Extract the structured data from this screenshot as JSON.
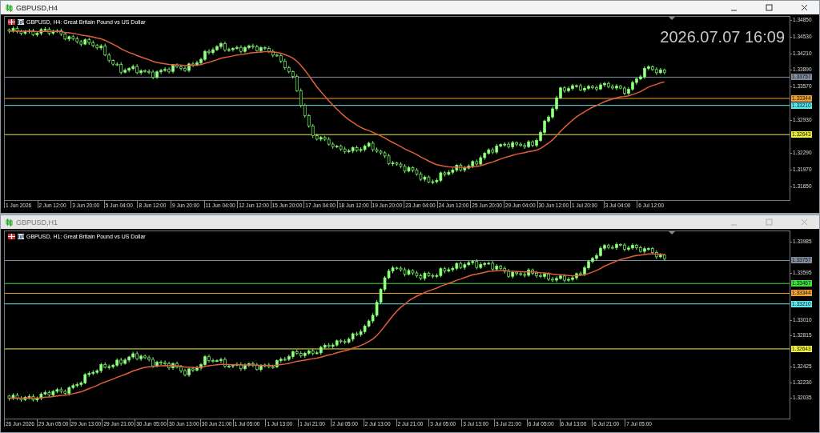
{
  "windows": [
    {
      "title": "GBPUSD,H4",
      "active": true,
      "chart": {
        "header": "GBPUSD, H4: Great Britain Pound vs US Dollar",
        "clock": "2026.07.07 16:09",
        "price_ticks": [
          "1.34850",
          "1.34530",
          "1.34210",
          "1.33890",
          "1.33570",
          "1.32930",
          "1.32290",
          "1.31970",
          "1.31650"
        ],
        "levels": [
          {
            "label": "1.33757",
            "color": "#7f8c9c"
          },
          {
            "label": "1.33344",
            "color": "#f0a030"
          },
          {
            "label": "1.33210",
            "color": "#5ee8f0"
          },
          {
            "label": "1.32643",
            "color": "#f0f040"
          }
        ],
        "time_labels": [
          "1 Jun 2026",
          "2 Jun 12:00",
          "3 Jun 20:00",
          "5 Jun 04:00",
          "8 Jun 12:00",
          "9 Jun 20:00",
          "11 Jun 04:00",
          "12 Jun 12:00",
          "15 Jun 20:00",
          "17 Jun 04:00",
          "18 Jun 12:00",
          "19 Jun 20:00",
          "23 Jun 04:00",
          "24 Jun 12:00",
          "25 Jun 20:00",
          "29 Jun 04:00",
          "30 Jun 12:00",
          "1 Jul 20:00",
          "3 Jul 04:00",
          "6 Jul 12:00"
        ]
      }
    },
    {
      "title": "GBPUSD,H1",
      "active": false,
      "chart": {
        "header": "GBPUSD, H1: Great Britain Pound vs US Dollar",
        "price_ticks": [
          "1.33985",
          "1.33595",
          "1.33010",
          "1.32815",
          "1.32425",
          "1.32230",
          "1.32035"
        ],
        "levels": [
          {
            "label": "1.33757",
            "color": "#7f8c9c"
          },
          {
            "label": "1.33467",
            "color": "#40e040"
          },
          {
            "label": "1.33344",
            "color": "#f0a030"
          },
          {
            "label": "1.33210",
            "color": "#5ee8f0"
          },
          {
            "label": "1.32643",
            "color": "#f0f040"
          }
        ],
        "time_labels": [
          "26 Jun 2026",
          "29 Jun 05:00",
          "29 Jun 13:00",
          "29 Jun 21:00",
          "30 Jun 05:00",
          "30 Jun 13:00",
          "30 Jun 21:00",
          "1 Jul 05:00",
          "1 Jul 13:00",
          "1 Jul 21:00",
          "2 Jul 05:00",
          "2 Jul 13:00",
          "2 Jul 21:00",
          "3 Jul 05:00",
          "3 Jul 13:00",
          "3 Jul 21:00",
          "6 Jul 05:00",
          "6 Jul 13:00",
          "6 Jul 21:00",
          "7 Jul 05:00"
        ]
      }
    }
  ]
}
